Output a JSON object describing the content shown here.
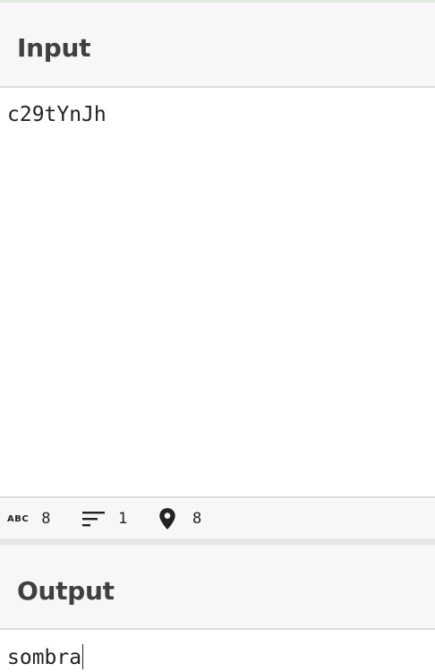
{
  "input": {
    "title": "Input",
    "value": "c29tYnJh"
  },
  "status_bar": {
    "length": "8",
    "lines": "1",
    "position": "8",
    "icons": {
      "length": "abc-icon",
      "lines": "lines-icon",
      "position": "location-pin-icon"
    }
  },
  "output": {
    "title": "Output",
    "value": "sombra"
  }
}
